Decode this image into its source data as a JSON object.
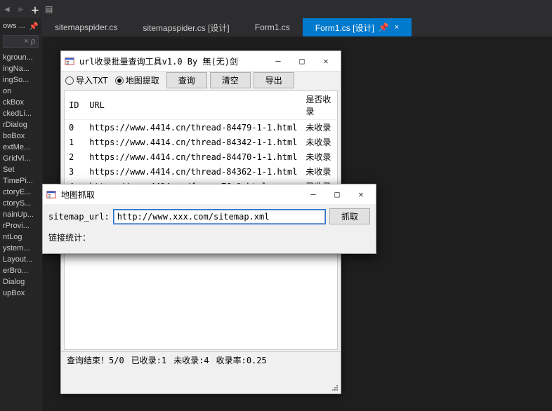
{
  "sidebar": {
    "header": "ows ...",
    "items": [
      "kgroun...",
      "ingNa...",
      "ingSo...",
      "on",
      "ckBox",
      "ckedLi...",
      "rDialog",
      "boBox",
      "extMe...",
      "GridVi...",
      "Set",
      "TimePi...",
      "ctoryE...",
      "ctoryS...",
      "nainUp...",
      "rProvi...",
      "ntLog",
      "ystem...",
      "Layout...",
      "erBro...",
      "Dialog",
      "upBox"
    ]
  },
  "tabs": [
    {
      "label": "sitemapspider.cs",
      "active": false
    },
    {
      "label": "sitemapspider.cs [设计]",
      "active": false
    },
    {
      "label": "Form1.cs",
      "active": false
    },
    {
      "label": "Form1.cs [设计]",
      "active": true,
      "pinned": true
    }
  ],
  "mainForm": {
    "title": "url收录批量查询工具v1.0 By 無(无)剑",
    "radios": {
      "importTxt": "导入TXT",
      "mapExtract": "地图提取"
    },
    "buttons": {
      "query": "查询",
      "clear": "清空",
      "export": "导出"
    },
    "columns": {
      "id": "ID",
      "url": "URL",
      "status": "是否收录"
    },
    "rows": [
      {
        "id": "0",
        "url": "https://www.4414.cn/thread-84479-1-1.html",
        "status": "未收录"
      },
      {
        "id": "1",
        "url": "https://www.4414.cn/thread-84342-1-1.html",
        "status": "未收录"
      },
      {
        "id": "2",
        "url": "https://www.4414.cn/thread-84470-1-1.html",
        "status": "未收录"
      },
      {
        "id": "3",
        "url": "https://www.4414.cn/thread-84362-1-1.html",
        "status": "未收录"
      },
      {
        "id": "4",
        "url": "https://www.4414.cn/forum-76-1.html",
        "status": "已收录"
      }
    ],
    "status": {
      "done": "查询结束！5/0",
      "indexed": "已收录:1",
      "notIndexed": "未收录:4",
      "rate": "收录率:0.25"
    }
  },
  "dialog": {
    "title": "地图抓取",
    "label": "sitemap_url:",
    "value": "http://www.xxx.com/sitemap.xml",
    "button": "抓取",
    "stats": "链接统计："
  }
}
